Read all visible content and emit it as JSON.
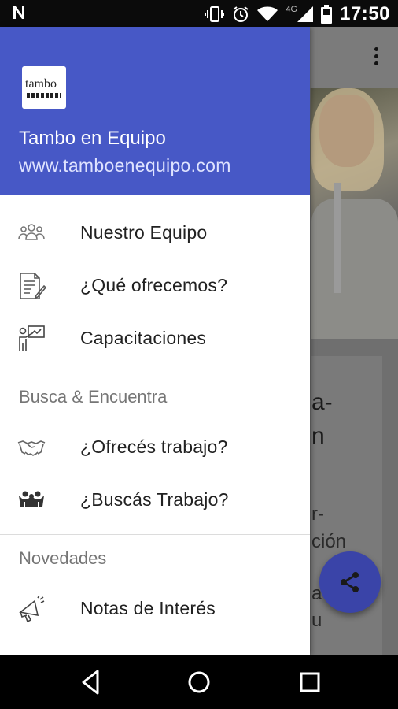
{
  "status_bar": {
    "time": "17:50",
    "network_label": "4G",
    "icons": [
      "n-notification-icon",
      "vibrate-icon",
      "alarm-icon",
      "wifi-icon",
      "signal-icon",
      "battery-icon"
    ]
  },
  "background_app": {
    "card_lines": [
      "a-",
      "n",
      "r-",
      "ción",
      "a",
      "u"
    ],
    "fab_icon": "share-icon"
  },
  "drawer": {
    "header": {
      "logo_text": "tambo",
      "app_name": "Tambo en Equipo",
      "url": "www.tamboenequipo.com",
      "color": "#4758c6"
    },
    "primary_items": [
      {
        "label": "Nuestro Equipo",
        "icon": "team-icon"
      },
      {
        "label": "¿Qué ofrecemos?",
        "icon": "document-edit-icon"
      },
      {
        "label": "Capacitaciones",
        "icon": "presentation-icon"
      }
    ],
    "sections": [
      {
        "title": "Busca & Encuentra",
        "items": [
          {
            "label": "¿Ofrecés trabajo?",
            "icon": "handshake-icon"
          },
          {
            "label": "¿Buscás Trabajo?",
            "icon": "people-icon"
          }
        ]
      },
      {
        "title": "Novedades",
        "items": [
          {
            "label": "Notas de Interés",
            "icon": "megaphone-icon"
          }
        ]
      }
    ]
  },
  "nav_bar": {
    "buttons": [
      "back-icon",
      "home-icon",
      "recents-icon"
    ]
  }
}
